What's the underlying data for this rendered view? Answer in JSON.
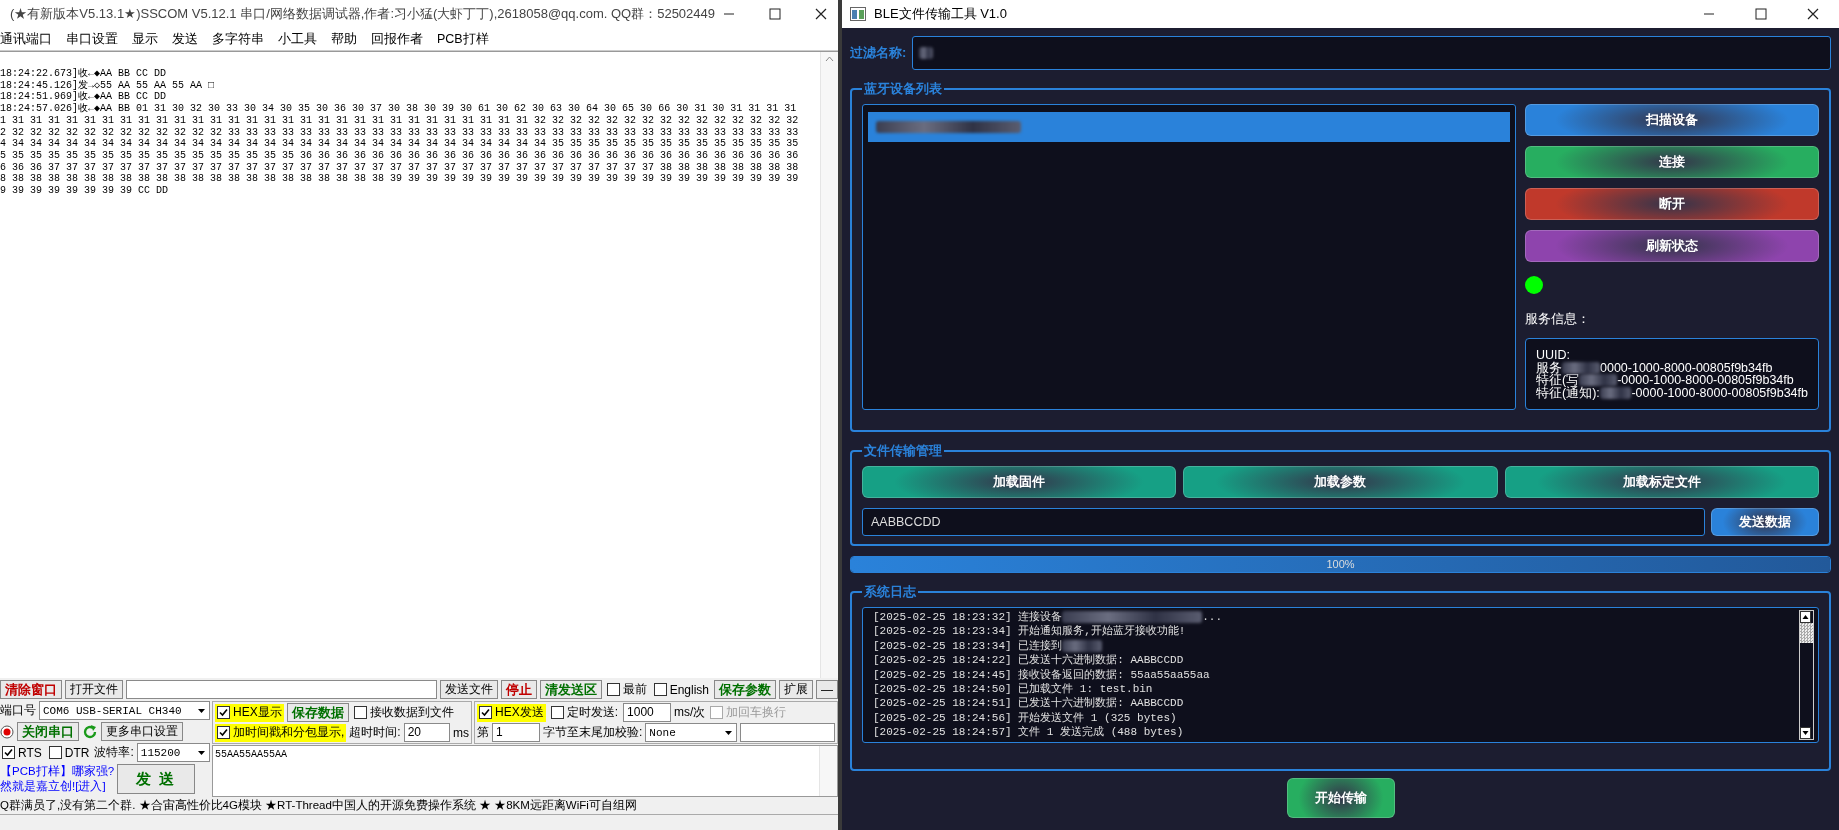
{
  "sscom": {
    "title": "(★有新版本V5.13.1★)SSCOM V5.12.1 串口/网络数据调试器,作者:习小猛(大虾丁丁),2618058@qq.com. QQ群：52502449",
    "menu": [
      "通讯端口",
      "串口设置",
      "显示",
      "发送",
      "多字符串",
      "小工具",
      "帮助",
      "回报作者",
      "PCB打样"
    ],
    "receive_lines": [
      "18:24:22.673]收←◆AA BB CC DD",
      "18:24:45.126]发→◇55 AA 55 AA 55 AA □",
      "18:24:51.969]收←◆AA BB CC DD",
      "18:24:57.026]收←◆AA BB 01 31 30 32 30 33 30 34 30 35 30 36 30 37 30 38 30 39 30 61 30 62 30 63 30 64 30 65 30 66 30 31 30 31 31 31 31",
      "1 31 31 31 31 31 31 31 31 31 31 31 31 31 31 31 31 31 31 31 31 31 31 31 31 31 31 31 31 31 32 32 32 32 32 32 32 32 32 32 32 32 32 32 32",
      "2 32 32 32 32 32 32 32 32 32 32 32 32 33 33 33 33 33 33 33 33 33 33 33 33 33 33 33 33 33 33 33 33 33 33 33 33 33 33 33 33 33 33 33 33",
      "4 34 34 34 34 34 34 34 34 34 34 34 34 34 34 34 34 34 34 34 34 34 34 34 34 34 34 34 34 34 34 35 35 35 35 35 35 35 35 35 35 35 35 35 35",
      "5 35 35 35 35 35 35 35 35 35 35 35 35 35 35 35 35 36 36 36 36 36 36 36 36 36 36 36 36 36 36 36 36 36 36 36 36 36 36 36 36 36 36 36 36",
      "6 36 36 37 37 37 37 37 37 37 37 37 37 37 37 37 37 37 37 37 37 37 37 37 37 37 37 37 37 37 37 37 37 37 37 37 37 38 38 38 38 38 38 38 38",
      "8 38 38 38 38 38 38 38 38 38 38 38 38 38 38 38 38 38 38 38 38 38 39 39 39 39 39 39 39 39 39 39 39 39 39 39 39 39 39 39 39 39 39 39 39",
      "9 39 39 39 39 39 39 39 CC DD"
    ],
    "toolbar": [
      {
        "kind": "button",
        "label": "清除窗口",
        "color": "#c00000"
      },
      {
        "kind": "button",
        "label": "打开文件"
      },
      {
        "kind": "input"
      },
      {
        "kind": "button",
        "label": "发送文件"
      },
      {
        "kind": "button",
        "label": "停止",
        "color": "#c00000"
      },
      {
        "kind": "button",
        "label": "清发送区",
        "color": "#007000"
      },
      {
        "kind": "checkbox",
        "label": "最前",
        "checked": false,
        "highlight": false,
        "disabled": false
      },
      {
        "kind": "checkbox",
        "label": "English",
        "checked": false,
        "highlight": false,
        "disabled": false
      },
      {
        "kind": "button",
        "label": "保存参数",
        "color": "#007000"
      },
      {
        "kind": "button",
        "label": "扩展"
      },
      {
        "kind": "button",
        "label": "—"
      }
    ],
    "left_rows": [
      [
        {
          "kind": "label",
          "label": "端口号"
        },
        {
          "kind": "combo",
          "value": "COM6 USB-SERIAL CH340"
        }
      ],
      [
        {
          "kind": "lamp"
        },
        {
          "kind": "button",
          "label": "关闭串口",
          "color": "#007000"
        },
        {
          "kind": "reload"
        },
        {
          "kind": "button",
          "label": "更多串口设置"
        }
      ],
      [
        {
          "kind": "checkbox",
          "label": "RTS",
          "checked": true,
          "highlight": false,
          "disabled": false
        },
        {
          "kind": "checkbox",
          "label": "DTR",
          "checked": false,
          "highlight": false,
          "disabled": false
        },
        {
          "kind": "label",
          "label": "波特率:"
        },
        {
          "kind": "combo",
          "value": "115200"
        }
      ]
    ],
    "links": [
      "【PCB打样】哪家强?",
      "然就是嘉立创![进入]"
    ],
    "send_button": {
      "label": "发 送",
      "color": "#007000"
    },
    "receive_panel": [
      [
        {
          "kind": "checkbox",
          "label": "HEX显示",
          "checked": true,
          "highlight": true,
          "disabled": false
        },
        {
          "kind": "button",
          "label": "保存数据",
          "color": "#007000"
        },
        {
          "kind": "checkbox",
          "label": "接收数据到文件",
          "checked": false,
          "highlight": false,
          "disabled": false
        }
      ],
      [
        {
          "kind": "checkbox",
          "label": "加时间戳和分包显示,",
          "checked": true,
          "highlight": true,
          "disabled": false
        },
        {
          "kind": "label",
          "label": "超时时间:"
        },
        {
          "kind": "input",
          "value": "20"
        },
        {
          "kind": "label",
          "label": "ms"
        }
      ]
    ],
    "send_panel": [
      [
        {
          "kind": "checkbox",
          "label": "HEX发送",
          "checked": true,
          "highlight": true,
          "disabled": false
        },
        {
          "kind": "checkbox",
          "label": "定时发送:",
          "checked": false,
          "highlight": false,
          "disabled": false
        },
        {
          "kind": "input",
          "value": "1000"
        },
        {
          "kind": "label",
          "label": "ms/次"
        },
        {
          "kind": "checkbox",
          "label": "加回车换行",
          "checked": false,
          "highlight": false,
          "disabled": true
        }
      ],
      [
        {
          "kind": "label",
          "label": "第"
        },
        {
          "kind": "input",
          "value": "1"
        },
        {
          "kind": "label",
          "label": "字节至末尾加校验:"
        },
        {
          "kind": "combo",
          "value": "None"
        },
        {
          "kind": "input"
        }
      ]
    ],
    "send_text": "55AA55AA55AA",
    "ticker": "Q群满员了,没有第二个群. ★合宙高性价比4G模块 ★RT-Thread中国人的开源免费操作系统 ★ ★8KM远距离WiFi可自组网"
  },
  "ble": {
    "title": "BLE文件传输工具 V1.0",
    "filter": {
      "label": "过滤名称:",
      "redacted": true
    },
    "device_group": {
      "title": "蓝牙设备列表",
      "devices": [
        {
          "selected": true,
          "redacted": true
        }
      ],
      "buttons": [
        {
          "label": "扫描设备",
          "color": "#2a82da"
        },
        {
          "label": "连接",
          "color": "#27ae60"
        },
        {
          "label": "断开",
          "color": "#c0392b"
        },
        {
          "label": "刷新状态",
          "color": "#8e44ad"
        }
      ],
      "status_dot": {
        "color": "#00ff00"
      },
      "service_label": "服务信息：",
      "service_lines": [
        {
          "text": "UUID:",
          "redacted": false
        },
        {
          "text": "服务",
          "redacted": true,
          "tail": "0000-1000-8000-00805f9b34fb"
        },
        {
          "text": "特征(写",
          "redacted": true,
          "tail": "-0000-1000-8000-00805f9b34fb"
        },
        {
          "text": "特征(通知):",
          "redacted": true,
          "tail": "-0000-1000-8000-00805f9b34fb"
        }
      ]
    },
    "file_group": {
      "title": "文件传输管理",
      "buttons": [
        "加载固件",
        "加载参数",
        "加载标定文件"
      ],
      "input": "AABBCCDD",
      "send_button": "发送数据"
    },
    "progress": {
      "level": 1,
      "text": "100%"
    },
    "log_group": {
      "title": "系统日志",
      "lines": [
        {
          "text": "[2025-02-25 18:23:32] 连接设备",
          "redacted": true,
          "tail": "..."
        },
        {
          "text": "[2025-02-25 18:23:34] 开始通知服务,开始蓝牙接收功能!",
          "redacted": false
        },
        {
          "text": "[2025-02-25 18:23:34] 已连接到",
          "redacted": true
        },
        {
          "text": "[2025-02-25 18:24:22] 已发送十六进制数据: AABBCCDD",
          "redacted": false
        },
        {
          "text": "[2025-02-25 18:24:45] 接收设备返回的数据: 55aa55aa55aa",
          "redacted": false
        },
        {
          "text": "[2025-02-25 18:24:50] 已加载文件 1: test.bin",
          "redacted": false
        },
        {
          "text": "[2025-02-25 18:24:51] 已发送十六进制数据: AABBCCDD",
          "redacted": false
        },
        {
          "text": "[2025-02-25 18:24:56] 开始发送文件 1 (325 bytes)",
          "redacted": false
        },
        {
          "text": "[2025-02-25 18:24:57] 文件 1 发送完成 (488 bytes)",
          "redacted": false
        }
      ]
    },
    "start_button": "开始传输"
  }
}
